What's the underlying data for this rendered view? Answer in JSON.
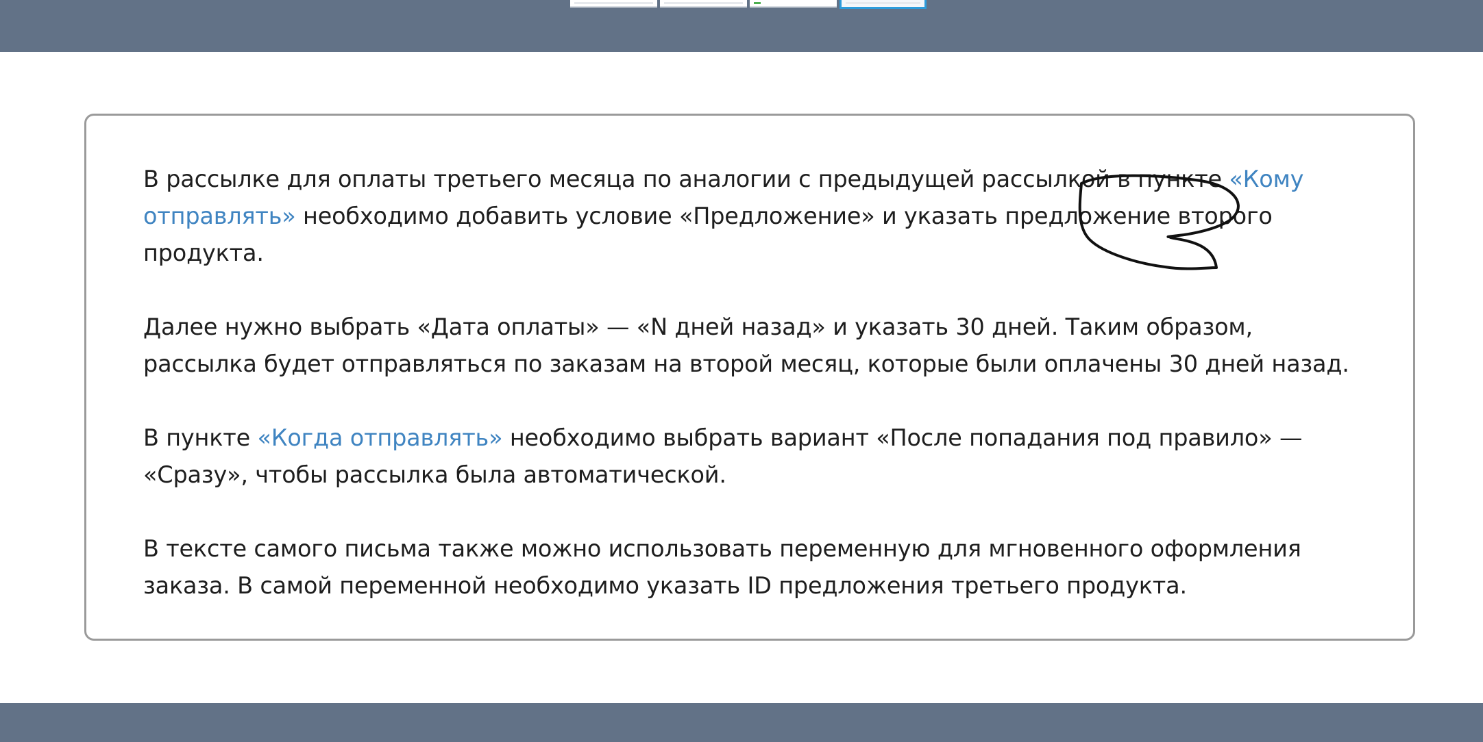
{
  "page": {
    "paragraphs": [
      {
        "segments": [
          {
            "text": "В рассылке для оплаты третьего месяца по аналогии с предыдущей рассылкой в пункте ",
            "link": false
          },
          {
            "text": "«Кому отправлять»",
            "link": true
          },
          {
            "text": " необходимо добавить условие «Предложение» и указать предложение второго продукта.",
            "link": false
          }
        ]
      },
      {
        "segments": [
          {
            "text": "Далее нужно выбрать «Дата оплаты» — «N дней назад» и указать 30 дней. Таким образом, рассылка будет отправляться по заказам на второй месяц, которые были оплачены 30 дней назад.",
            "link": false
          }
        ]
      },
      {
        "segments": [
          {
            "text": "В пункте ",
            "link": false
          },
          {
            "text": "«Когда отправлять»",
            "link": true
          },
          {
            "text": " необходимо выбрать вариант «После попадания под правило» — «Сразу», чтобы рассылка была автоматической.",
            "link": false
          }
        ]
      },
      {
        "segments": [
          {
            "text": "В тексте самого письма также можно использовать переменную для мгновенного оформления заказа. В самой переменной необходимо указать ID предложения третьего продукта.",
            "link": false
          }
        ]
      }
    ]
  },
  "colors": {
    "header_bar": "#627287",
    "link": "#3f84c1",
    "text": "#1e1e1e",
    "card_border": "#9a9a9a",
    "active_thumb": "#2d9cdb"
  },
  "thumbnails": {
    "count": 4,
    "active_index": 3
  }
}
